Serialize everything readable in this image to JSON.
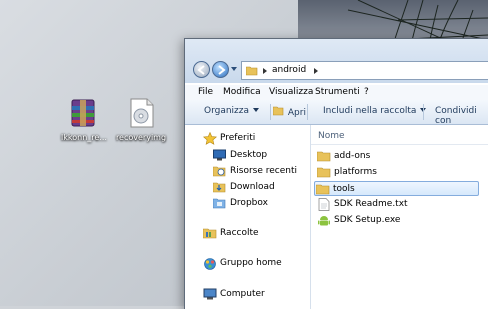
{
  "desktop": {
    "icons": [
      {
        "label": "lkkonn_re...",
        "icon": "winrar-archive-icon"
      },
      {
        "label": "recoveryimg",
        "icon": "disc-image-icon"
      }
    ]
  },
  "explorer": {
    "breadcrumb": [
      "android"
    ],
    "menu": [
      "File",
      "Modifica",
      "Visualizza",
      "Strumenti",
      "?"
    ],
    "toolbar": {
      "organize": "Organizza",
      "open": "Apri",
      "include": "Includi nella raccolta",
      "share": "Condividi con"
    },
    "nav": {
      "favorites": "Preferiti",
      "desktop": "Desktop",
      "recent": "Risorse recenti",
      "download": "Download",
      "dropbox": "Dropbox",
      "libraries": "Raccolte",
      "homegroup": "Gruppo home",
      "computer": "Computer"
    },
    "column_name": "Nome",
    "files": [
      {
        "name": "add-ons",
        "type": "folder"
      },
      {
        "name": "platforms",
        "type": "folder"
      },
      {
        "name": "tools",
        "type": "folder",
        "selected": true
      },
      {
        "name": "SDK Readme.txt",
        "type": "text"
      },
      {
        "name": "SDK Setup.exe",
        "type": "exe"
      }
    ]
  },
  "colors": {
    "accent": "#1e395b",
    "selection": "#d6e9fc",
    "folder": "#e8c25a"
  }
}
